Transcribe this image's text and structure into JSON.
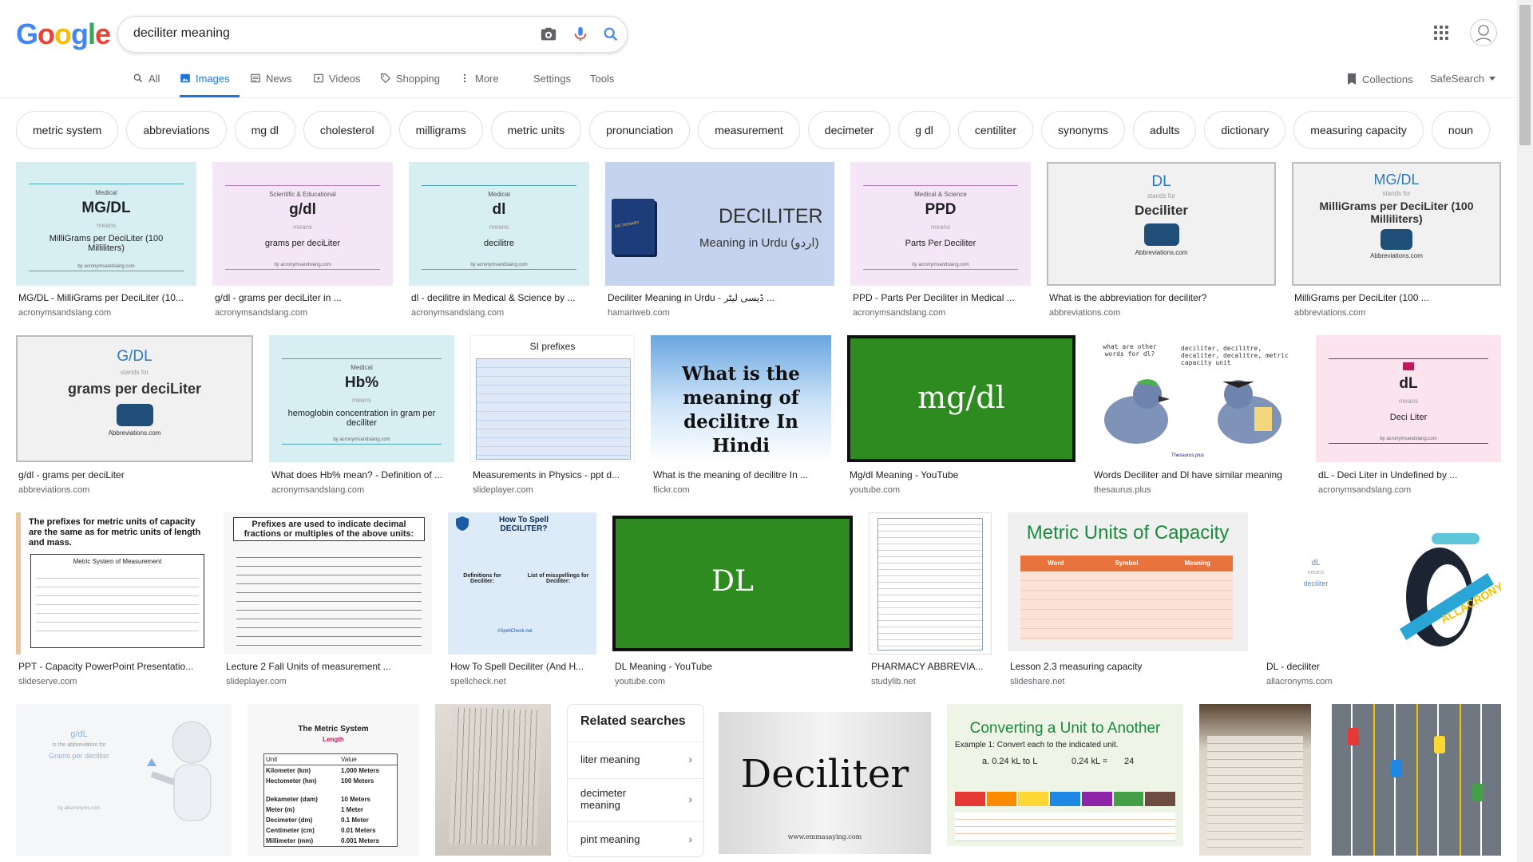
{
  "header": {
    "logo": "Google",
    "search_value": "deciliter meaning"
  },
  "tabs": [
    {
      "label": "All"
    },
    {
      "label": "Images"
    },
    {
      "label": "News"
    },
    {
      "label": "Videos"
    },
    {
      "label": "Shopping"
    },
    {
      "label": "More"
    }
  ],
  "settings_label": "Settings",
  "tools_label": "Tools",
  "collections_label": "Collections",
  "safesearch_label": "SafeSearch",
  "chips": [
    "metric system",
    "abbreviations",
    "mg dl",
    "cholesterol",
    "milligrams",
    "metric units",
    "pronunciation",
    "measurement",
    "decimeter",
    "g dl",
    "centiliter",
    "synonyms",
    "adults",
    "dictionary",
    "measuring capacity",
    "noun"
  ],
  "results": [
    {
      "title": "MG/DL - MilliGrams per DeciLiter (10...",
      "source": "acronymsandslang.com",
      "t1": "Medical",
      "t2": "MG/DL",
      "t3": "means",
      "t4": "MilliGrams per DeciLiter (100 Milliliters)",
      "t5": "by acronymsandslang.com"
    },
    {
      "title": "g/dl - grams per deciLiter in ...",
      "source": "acronymsandslang.com",
      "t1": "Scientific & Educational",
      "t2": "g/dl",
      "t3": "means",
      "t4": "grams per deciLiter",
      "t5": "by acronymsandslang.com"
    },
    {
      "title": "dl - decilitre in Medical & Science by ...",
      "source": "acronymsandslang.com",
      "t1": "Medical",
      "t2": "dl",
      "t3": "means",
      "t4": "decilitre",
      "t5": "by acronymsandslang.com"
    },
    {
      "title": "Deciliter Meaning in Urdu - ڈیسی لیٹر ...",
      "source": "hamariweb.com",
      "t1": "DECILITER",
      "t2": "Meaning in Urdu (اردو)",
      "t3": "DICTIONARY"
    },
    {
      "title": "PPD - Parts Per Deciliter in Medical ...",
      "source": "acronymsandslang.com",
      "t1": "Medical & Science",
      "t2": "PPD",
      "t3": "means",
      "t4": "Parts Per Deciliter",
      "t5": "by acronymsandslang.com"
    },
    {
      "title": "What is the abbreviation for deciliter?",
      "source": "abbreviations.com",
      "t1": "DL",
      "t2": "stands for",
      "t3": "Deciliter",
      "t4": "Abbreviations.com"
    },
    {
      "title": "MilliGrams per DeciLiter (100 ...",
      "source": "abbreviations.com",
      "t1": "MG/DL",
      "t2": "stands for",
      "t3": "MilliGrams per DeciLiter (100 Milliliters)",
      "t4": "Abbreviations.com"
    },
    {
      "title": "g/dl - grams per deciLiter",
      "source": "abbreviations.com",
      "t1": "G/DL",
      "t2": "stands for",
      "t3": "grams per deciLiter",
      "t4": "Abbreviations.com"
    },
    {
      "title": "What does Hb% mean? - Definition of ...",
      "source": "acronymsandslang.com",
      "t1": "Medical",
      "t2": "Hb%",
      "t3": "means",
      "t4": "hemoglobin concentration in gram per deciliter",
      "t5": "by acronymsandslang.com"
    },
    {
      "title": "Measurements in Physics - ppt d...",
      "source": "slideplayer.com",
      "t1": "SI prefixes"
    },
    {
      "title": "What is the meaning of decilitre In ...",
      "source": "flickr.com",
      "t1": "What is the meaning of decilitre In Hindi"
    },
    {
      "title": "Mg/dl Meaning - YouTube",
      "source": "youtube.com",
      "t1": "mg/dl"
    },
    {
      "title": "Words Deciliter and Dl have similar meaning",
      "source": "thesaurus.plus",
      "t1": "what are other words for dl?",
      "t2": "deciliter, decilitre, decaliter, decalitre, metric capacity unit",
      "t3": "Thesaurus.plus"
    },
    {
      "title": "dL - Deci Liter in Undefined by ...",
      "source": "acronymsandslang.com",
      "t1": "dL",
      "t2": "means",
      "t3": "Deci Liter",
      "t4": "by acronymsandslang.com"
    },
    {
      "title": "PPT - Capacity PowerPoint Presentatio...",
      "source": "slideserve.com",
      "t1": "The prefixes for metric units of capacity are the same as for metric units of length and mass.",
      "t2": "Metric System of Measurement"
    },
    {
      "title": "Lecture 2 Fall Units of measurement ...",
      "source": "slideplayer.com",
      "t1": "Prefixes are used to indicate decimal fractions or multiples of the above units:"
    },
    {
      "title": "How To Spell Deciliter (And H...",
      "source": "spellcheck.net",
      "t1": "How To Spell DECILITER?",
      "t2": "Definitions for Deciliter:",
      "t3": "List of misspellings for Deciliter:",
      "t4": "#SpellCheck.net"
    },
    {
      "title": "DL Meaning - YouTube",
      "source": "youtube.com",
      "t1": "DL"
    },
    {
      "title": "PHARMACY ABBREVIA...",
      "source": "studylib.net"
    },
    {
      "title": "Lesson 2.3 measuring capacity",
      "source": "slideshare.net",
      "t1": "Metric Units of Capacity",
      "h1": "Word",
      "h2": "Symbol",
      "h3": "Meaning"
    },
    {
      "title": "DL - deciliter",
      "source": "allacronyms.com",
      "t1": "dL",
      "t2": "means",
      "t3": "deciliter",
      "t4": "ALLACRONYMS"
    }
  ],
  "row4": {
    "r1": {
      "t1": "g/dL",
      "t2": "is the abbreviation for",
      "t3": "Grams per deciliter",
      "t4": "by allacronyms.com"
    },
    "r2": {
      "t1": "The Metric System",
      "t2": "Length",
      "h1": "Unit",
      "h2": "Value",
      "rows": [
        [
          "Kilometer (km)",
          "1,000 Meters"
        ],
        [
          "Hectometer (hm)",
          "100 Meters"
        ],
        [
          "Dekameter (dam)",
          "10 Meters"
        ],
        [
          "Meter (m)",
          "1 Meter"
        ],
        [
          "Decimeter (dm)",
          "0.1 Meter"
        ],
        [
          "Centimeter (cm)",
          "0.01 Meters"
        ],
        [
          "Millimeter (mm)",
          "0.001 Meters"
        ]
      ]
    },
    "r4": {
      "t1": "Deciliter",
      "t2": "www.emmasaying.com"
    },
    "r5": {
      "t1": "Converting a Unit to Another",
      "t2": "Example 1: Convert each to the indicated unit.",
      "t3": "a. 0.24 kL to L",
      "t4": "0.24 kL =",
      "t5": "24"
    }
  },
  "related": {
    "title": "Related searches",
    "items": [
      "liter meaning",
      "decimeter meaning",
      "pint meaning"
    ]
  },
  "colors": {
    "accent": "#1a73e8",
    "text": "#202124",
    "muted": "#5f6368"
  }
}
